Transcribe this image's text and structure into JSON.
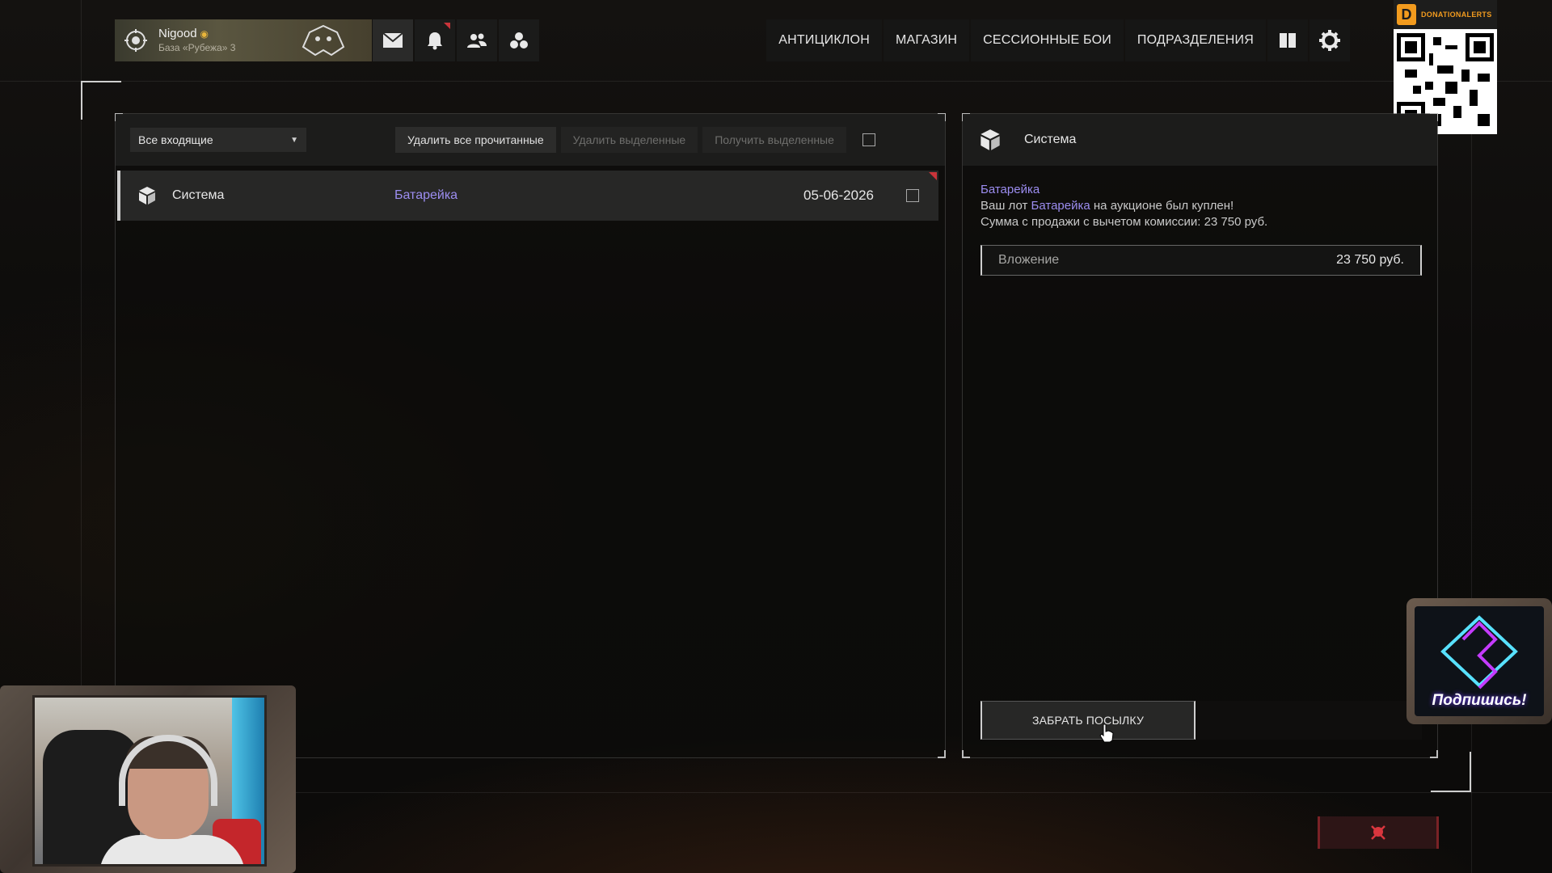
{
  "profile": {
    "nickname": "Nigood",
    "base": "База «Рубежа» 3"
  },
  "top_icons": [
    "mail-icon",
    "bell-icon",
    "friends-icon",
    "squad-icon"
  ],
  "nav": {
    "items": [
      "АНТИЦИКЛОН",
      "МАГАЗИН",
      "СЕССИОННЫЕ БОИ",
      "ПОДРАЗДЕЛЕНИЯ"
    ],
    "icons": [
      "book-icon",
      "gear-icon"
    ]
  },
  "donation": {
    "logo": "D",
    "label": "DONATIONALERTS"
  },
  "mail": {
    "filter_selected": "Все входящие",
    "delete_read_label": "Удалить все прочитанные",
    "delete_selected_label": "Удалить выделенные",
    "get_selected_label": "Получить выделенные",
    "messages": [
      {
        "sender": "Система",
        "subject": "Батарейка",
        "date": "05-06-2026",
        "unread": true
      }
    ]
  },
  "detail": {
    "sender": "Система",
    "subject": "Батарейка",
    "line1_before": "Ваш лот ",
    "line1_item": "Батарейка",
    "line1_after": " на аукционе был куплен!",
    "line2": "Сумма с продажи с вычетом комиссии: 23 750 руб.",
    "attachment_label": "Вложение",
    "attachment_amount": "23 750 руб.",
    "claim_button": "ЗАБРАТЬ ПОСЫЛКУ"
  },
  "overlay": {
    "subscribe_label": "Подпишись!"
  },
  "colors": {
    "accent_purple": "#9c8df0",
    "alert_red": "#c9343a",
    "panel_bg": "#1c1c1b",
    "row_bg": "#272726"
  }
}
